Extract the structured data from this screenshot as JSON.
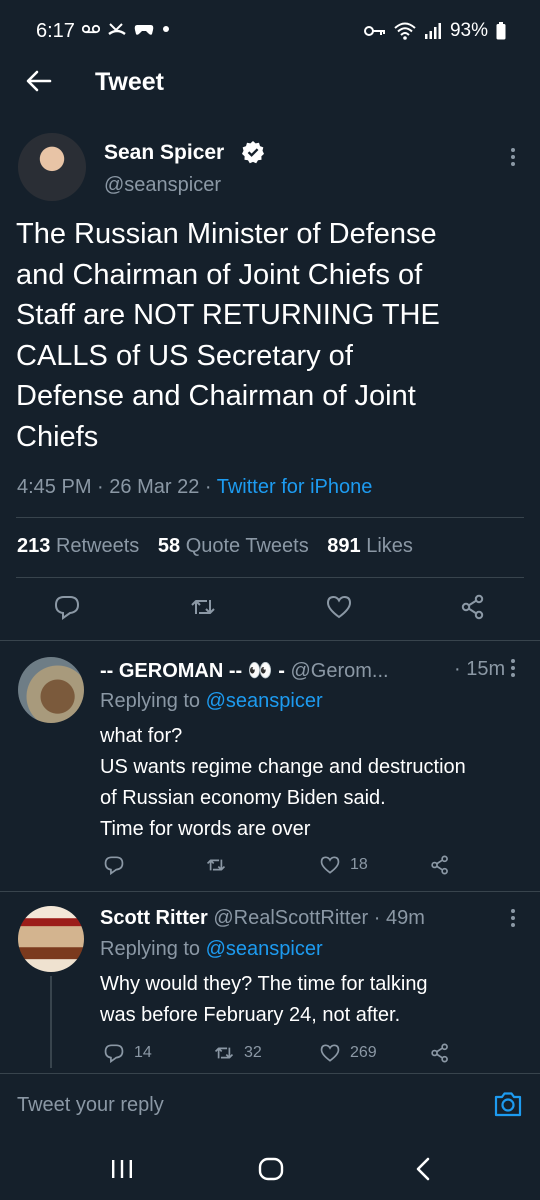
{
  "status_bar": {
    "time": "6:17",
    "battery": "93%",
    "left_icons": [
      "voicemail-icon",
      "missed-call-icon",
      "game-icon",
      "dot-icon"
    ],
    "right_icons": [
      "key-icon",
      "wifi-icon",
      "signal-icon",
      "battery-icon"
    ]
  },
  "header": {
    "title": "Tweet"
  },
  "main_tweet": {
    "author_name": "Sean Spicer",
    "handle": "@seanspicer",
    "text": "The Russian Minister of Defense\nand Chairman of Joint Chiefs of\nStaff are NOT RETURNING THE\nCALLS of US Secretary of\nDefense and Chairman of Joint\nChiefs",
    "time": "4:45 PM",
    "date": "26 Mar 22",
    "source": "Twitter for iPhone",
    "stats": {
      "retweets_count": "213",
      "retweets_label": "Retweets",
      "quotes_count": "58",
      "quotes_label": "Quote Tweets",
      "likes_count": "891",
      "likes_label": "Likes"
    }
  },
  "replies": [
    {
      "author_name": "-- GEROMAN --",
      "emoji": "👀",
      "name_suffix": "-",
      "handle": "@Gerom...",
      "age": "15m",
      "replying_label": "Replying to",
      "replying_to": "@seanspicer",
      "text": "what for?\nUS wants regime change and destruction\nof Russian economy Biden said.\nTime for words are over",
      "replies_count": "",
      "retweets_count": "",
      "likes_count": "18"
    },
    {
      "author_name": "Scott Ritter",
      "handle": "@RealScottRitter",
      "age": "49m",
      "replying_label": "Replying to",
      "replying_to": "@seanspicer",
      "text": "Why would they? The time for talking\nwas before February 24, not after.",
      "replies_count": "14",
      "retweets_count": "32",
      "likes_count": "269"
    }
  ],
  "composer": {
    "placeholder": "Tweet your reply"
  },
  "colors": {
    "background": "#15202b",
    "accent": "#1d9bf0",
    "muted": "#8b98a5",
    "divider": "#38444d"
  }
}
